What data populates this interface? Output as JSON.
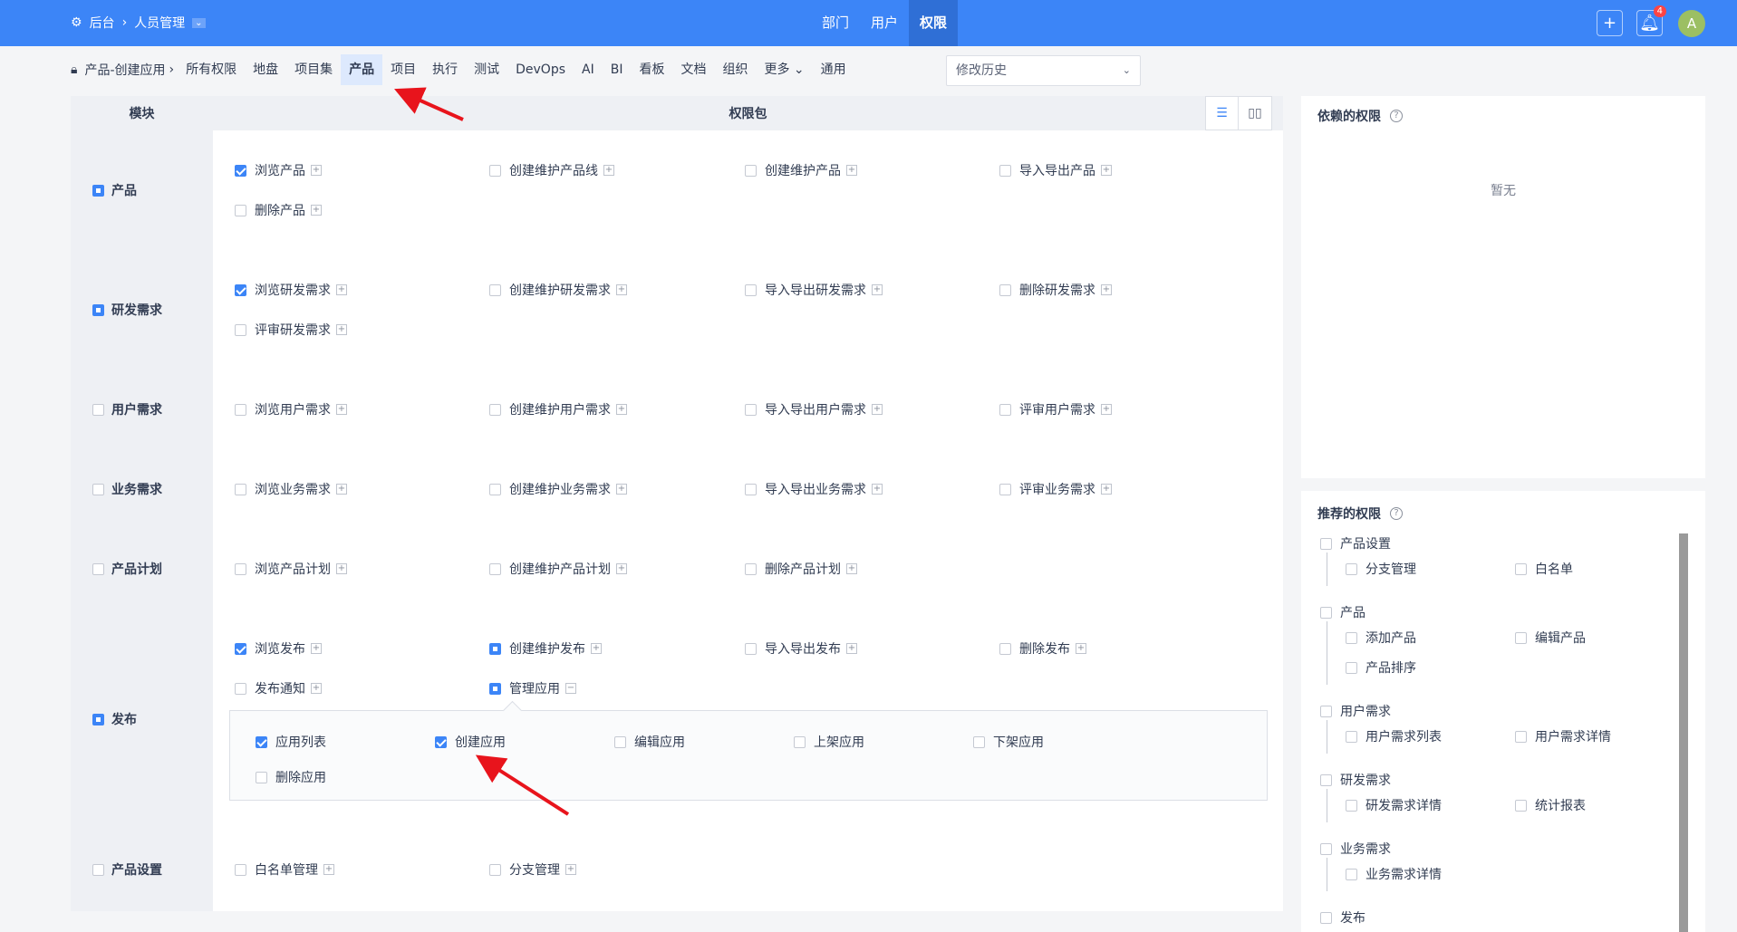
{
  "header": {
    "breadcrumb_root": "后台",
    "breadcrumb_current": "人员管理",
    "nav": [
      "部门",
      "用户",
      "权限"
    ],
    "active_nav": "权限",
    "notification_count": "4",
    "avatar_letter": "A",
    "accent": "#3c85f7"
  },
  "subnav": {
    "context": "产品-创建应用",
    "items": [
      "所有权限",
      "地盘",
      "项目集",
      "产品",
      "项目",
      "执行",
      "测试",
      "DevOps",
      "AI",
      "BI",
      "看板",
      "文档",
      "组织",
      "更多",
      "通用"
    ],
    "active": "产品",
    "history_select": "修改历史"
  },
  "table": {
    "col_module": "模块",
    "col_package": "权限包",
    "rows": [
      {
        "module": "产品",
        "state": "ind",
        "items": [
          [
            "浏览产品",
            "checked"
          ],
          [
            "创建维护产品线",
            ""
          ],
          [
            "创建维护产品",
            ""
          ],
          [
            "导入导出产品",
            ""
          ],
          [
            "删除产品",
            ""
          ]
        ]
      },
      {
        "module": "研发需求",
        "state": "ind",
        "items": [
          [
            "浏览研发需求",
            "checked"
          ],
          [
            "创建维护研发需求",
            ""
          ],
          [
            "导入导出研发需求",
            ""
          ],
          [
            "删除研发需求",
            ""
          ],
          [
            "评审研发需求",
            ""
          ]
        ]
      },
      {
        "module": "用户需求",
        "state": "",
        "items": [
          [
            "浏览用户需求",
            ""
          ],
          [
            "创建维护用户需求",
            ""
          ],
          [
            "导入导出用户需求",
            ""
          ],
          [
            "评审用户需求",
            ""
          ]
        ]
      },
      {
        "module": "业务需求",
        "state": "",
        "items": [
          [
            "浏览业务需求",
            ""
          ],
          [
            "创建维护业务需求",
            ""
          ],
          [
            "导入导出业务需求",
            ""
          ],
          [
            "评审业务需求",
            ""
          ]
        ]
      },
      {
        "module": "产品计划",
        "state": "",
        "items": [
          [
            "浏览产品计划",
            ""
          ],
          [
            "创建维护产品计划",
            ""
          ],
          [
            "删除产品计划",
            ""
          ]
        ]
      },
      {
        "module": "发布",
        "state": "ind",
        "items": [
          [
            "浏览发布",
            "checked"
          ],
          [
            "创建维护发布",
            "ind"
          ],
          [
            "导入导出发布",
            ""
          ],
          [
            "删除发布",
            ""
          ],
          [
            "发布通知",
            ""
          ],
          [
            "管理应用",
            "ind",
            "expanded"
          ]
        ],
        "expanded_items": [
          [
            "应用列表",
            "checked"
          ],
          [
            "创建应用",
            "checked"
          ],
          [
            "编辑应用",
            ""
          ],
          [
            "上架应用",
            ""
          ],
          [
            "下架应用",
            ""
          ],
          [
            "删除应用",
            ""
          ]
        ]
      },
      {
        "module": "产品设置",
        "state": "",
        "items": [
          [
            "白名单管理",
            ""
          ],
          [
            "分支管理",
            ""
          ]
        ]
      }
    ]
  },
  "depends": {
    "title": "依赖的权限",
    "empty": "暂无"
  },
  "recommend": {
    "title": "推荐的权限",
    "groups": [
      {
        "label": "产品设置",
        "children": [
          "分支管理",
          "白名单"
        ]
      },
      {
        "label": "产品",
        "children": [
          "添加产品",
          "编辑产品",
          "产品排序"
        ]
      },
      {
        "label": "用户需求",
        "children": [
          "用户需求列表",
          "用户需求详情"
        ]
      },
      {
        "label": "研发需求",
        "children": [
          "研发需求详情",
          "统计报表"
        ]
      },
      {
        "label": "业务需求",
        "children": [
          "业务需求详情"
        ]
      },
      {
        "label": "发布",
        "children": []
      }
    ]
  }
}
